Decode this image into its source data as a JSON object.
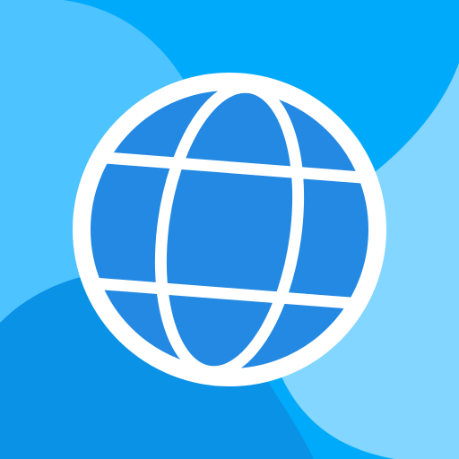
{
  "icon": {
    "name": "globe-icon",
    "colors": {
      "background_top_right": "#00AAFA",
      "background_top_left": "#4DC3FF",
      "background_bottom_left": "#0A92E6",
      "background_bottom_right": "#82D6FF",
      "globe_fill": "#2489E3",
      "globe_stroke": "#FFFFFF"
    }
  }
}
